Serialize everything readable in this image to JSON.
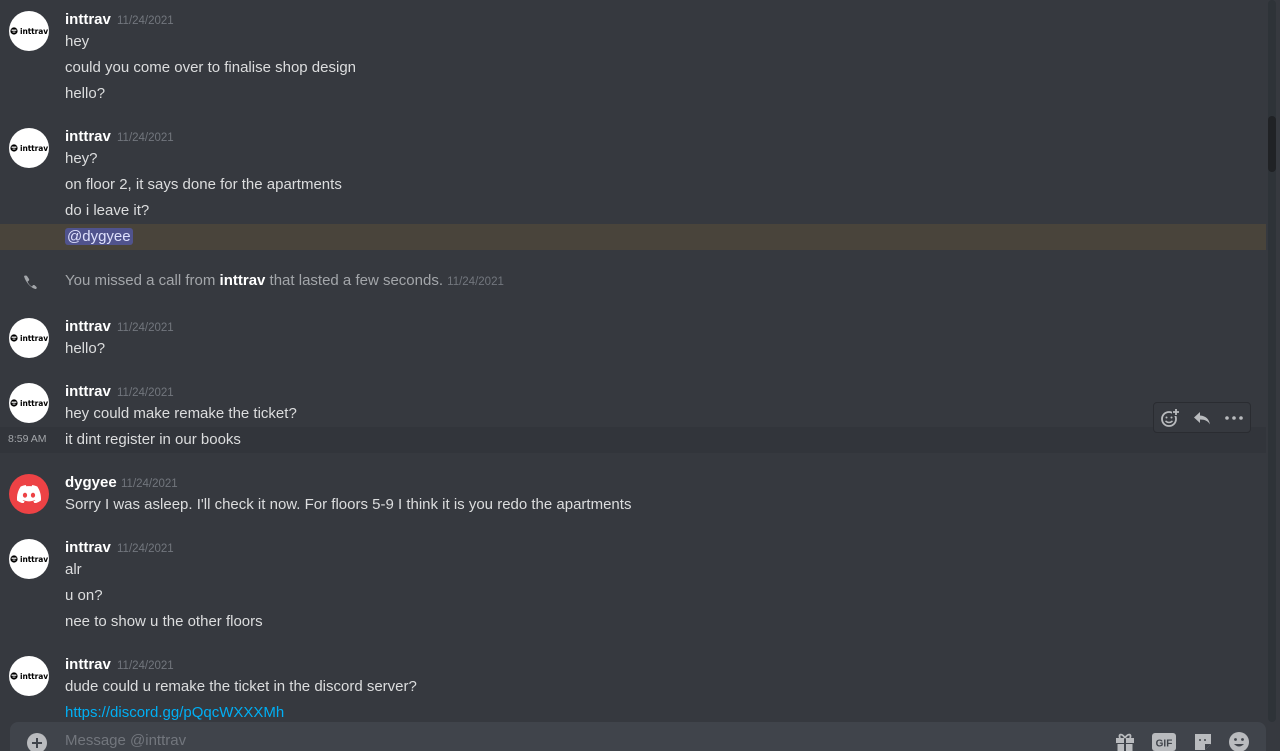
{
  "conversation": {
    "groups": [
      {
        "author": "inttrav",
        "timestamp": "11/24/2021",
        "lines": [
          "hey",
          "could you come over to finalise shop design",
          "hello?"
        ]
      },
      {
        "author": "inttrav",
        "timestamp": "11/24/2021",
        "lines": [
          "hey?",
          "on floor 2, it says done for the apartments",
          "do i leave it?"
        ],
        "mention": "@dygyee"
      },
      {
        "author": "inttrav",
        "timestamp": "11/24/2021",
        "lines": [
          "hello?"
        ]
      },
      {
        "author": "inttrav",
        "timestamp": "11/24/2021",
        "lines": [
          "hey could make remake the ticket?",
          "it dint register in our books"
        ],
        "hover_time": "8:59 AM"
      },
      {
        "author": "dygyee",
        "timestamp": "11/24/2021",
        "lines": [
          "Sorry I was asleep. I'll check it now. For floors 5-9 I think it is you redo the apartments"
        ]
      },
      {
        "author": "inttrav",
        "timestamp": "11/24/2021",
        "lines": [
          "alr",
          "u on?",
          "nee to show u the other floors"
        ]
      },
      {
        "author": "inttrav",
        "timestamp": "11/24/2021",
        "lines": [
          "dude could u remake the ticket in the discord server?"
        ],
        "link": "https://discord.gg/pQqcWXXXMh"
      }
    ],
    "system_call": {
      "prefix": "You missed a call from",
      "caller": "inttrav",
      "suffix": "that lasted a few seconds.",
      "timestamp": "11/24/2021"
    }
  },
  "avatar_text": "inttrav",
  "composer": {
    "placeholder": "Message @inttrav",
    "gif_label": "GIF"
  },
  "icons": {
    "call": "phone-missed-icon",
    "toolbar": [
      "add-reaction-icon",
      "reply-icon",
      "more-options-icon"
    ],
    "composer": [
      "add-attachment-icon",
      "gift-icon",
      "gif-icon",
      "sticker-icon",
      "emoji-icon"
    ]
  },
  "colors": {
    "background": "#36393f",
    "mention_highlight": "#faa81a",
    "link": "#00aff4",
    "discord_avatar": "#ed4245"
  }
}
